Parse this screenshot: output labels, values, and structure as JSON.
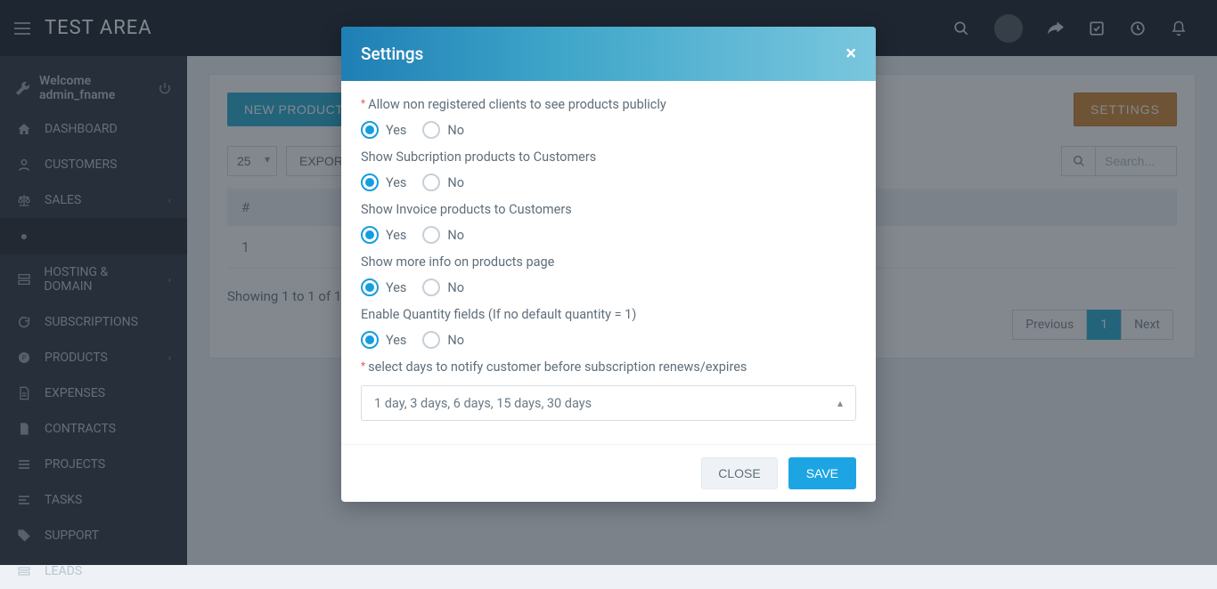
{
  "header": {
    "brand": "TEST AREA"
  },
  "welcome": {
    "prefix": "Welcome",
    "user": "admin_fname"
  },
  "nav": {
    "dashboard": "DASHBOARD",
    "customers": "CUSTOMERS",
    "sales": "SALES",
    "hosting": "HOSTING & DOMAIN",
    "subscriptions": "SUBSCRIPTIONS",
    "products": "PRODUCTS",
    "expenses": "EXPENSES",
    "contracts": "CONTRACTS",
    "projects": "PROJECTS",
    "tasks": "TASKS",
    "support": "SUPPORT",
    "leads": "LEADS"
  },
  "page": {
    "new_group_btn": "NEW PRODUCT G",
    "settings_btn": "SETTINGS",
    "page_size": "25",
    "export_btn": "EXPOR",
    "search_placeholder": "Search...",
    "col_num": "#",
    "row1_num": "1",
    "summary": "Showing 1 to 1 of 1 e",
    "pager_prev": "Previous",
    "pager_1": "1",
    "pager_next": "Next"
  },
  "modal": {
    "title": "Settings",
    "fields": {
      "allow_public": {
        "label": "Allow non registered clients to see products publicly",
        "yes": "Yes",
        "no": "No"
      },
      "show_sub": {
        "label": "Show Subcription products to Customers",
        "yes": "Yes",
        "no": "No"
      },
      "show_inv": {
        "label": "Show Invoice products to Customers",
        "yes": "Yes",
        "no": "No"
      },
      "more_info": {
        "label": "Show more info on products page",
        "yes": "Yes",
        "no": "No"
      },
      "qty": {
        "label": "Enable Quantity fields (If no default quantity = 1)",
        "yes": "Yes",
        "no": "No"
      },
      "notify_days": {
        "label": "select days to notify customer before subscription renews/expires",
        "value": "1 day, 3 days, 6 days, 15 days, 30 days"
      }
    },
    "close": "CLOSE",
    "save": "SAVE"
  }
}
